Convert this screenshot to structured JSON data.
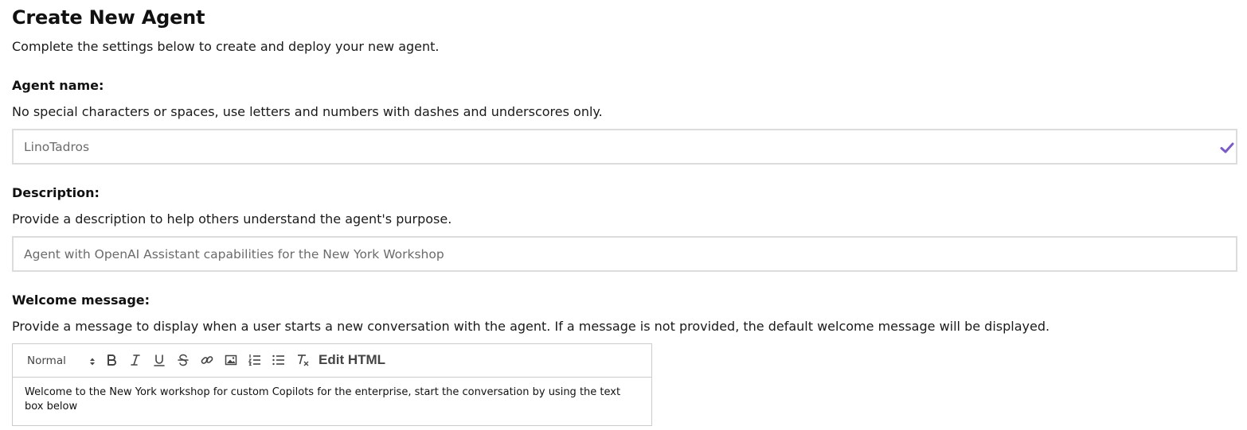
{
  "header": {
    "title": "Create New Agent",
    "subtitle": "Complete the settings below to create and deploy your new agent."
  },
  "agent_name": {
    "label": "Agent name:",
    "help": "No special characters or spaces, use letters and numbers with dashes and underscores only.",
    "value": "LinoTadros",
    "valid_icon": "check-icon",
    "valid_color": "#7b5cc4"
  },
  "description": {
    "label": "Description:",
    "help": "Provide a description to help others understand the agent's purpose.",
    "value": "Agent with OpenAI Assistant capabilities for the New York Workshop"
  },
  "welcome_message": {
    "label": "Welcome message:",
    "help": "Provide a message to display when a user starts a new conversation with the agent. If a message is not provided, the default welcome message will be displayed.",
    "toolbar": {
      "format_value": "Normal",
      "tools": [
        "bold-icon",
        "italic-icon",
        "underline-icon",
        "strikethrough-icon",
        "link-icon",
        "image-icon",
        "ordered-list-icon",
        "bullet-list-icon",
        "clear-format-icon"
      ],
      "edit_html_label": "Edit HTML"
    },
    "content": "Welcome to the New York workshop for custom Copilots for the enterprise, start the conversation by using the text box below"
  }
}
